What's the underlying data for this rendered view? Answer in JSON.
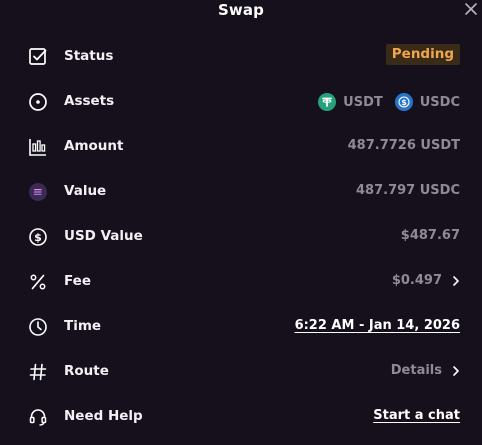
{
  "header": {
    "title": "Swap"
  },
  "rows": {
    "status": {
      "label": "Status",
      "value": "Pending"
    },
    "assets": {
      "label": "Assets",
      "from": "USDT",
      "to": "USDC"
    },
    "amount": {
      "label": "Amount",
      "value": "487.7726 USDT"
    },
    "value": {
      "label": "Value",
      "value": "487.797 USDC"
    },
    "usd_value": {
      "label": "USD Value",
      "value": "$487.67"
    },
    "fee": {
      "label": "Fee",
      "value": "$0.497"
    },
    "time": {
      "label": "Time",
      "value": "6:22 AM - Jan 14, 2026"
    },
    "route": {
      "label": "Route",
      "value": "Details"
    },
    "help": {
      "label": "Need Help",
      "value": "Start a chat"
    }
  },
  "icons": {
    "close": "close-icon",
    "status": "checkbox-icon",
    "assets": "circle-dot-icon",
    "amount": "chart-icon",
    "value": "solana-icon",
    "usd_value": "dollar-circle-icon",
    "fee": "percent-icon",
    "time": "clock-icon",
    "route": "hash-icon",
    "help": "headset-icon",
    "usdt": "usdt-icon",
    "usdc": "usdc-icon",
    "chevron": "chevron-right-icon"
  },
  "colors": {
    "background": "#15101c",
    "pending_text": "#f0a64c",
    "pending_bg": "#3a2a18",
    "muted": "#8f8a96",
    "usdt": "#26a17b",
    "usdc": "#2775ca",
    "solana_bg": "#3b2a52"
  }
}
